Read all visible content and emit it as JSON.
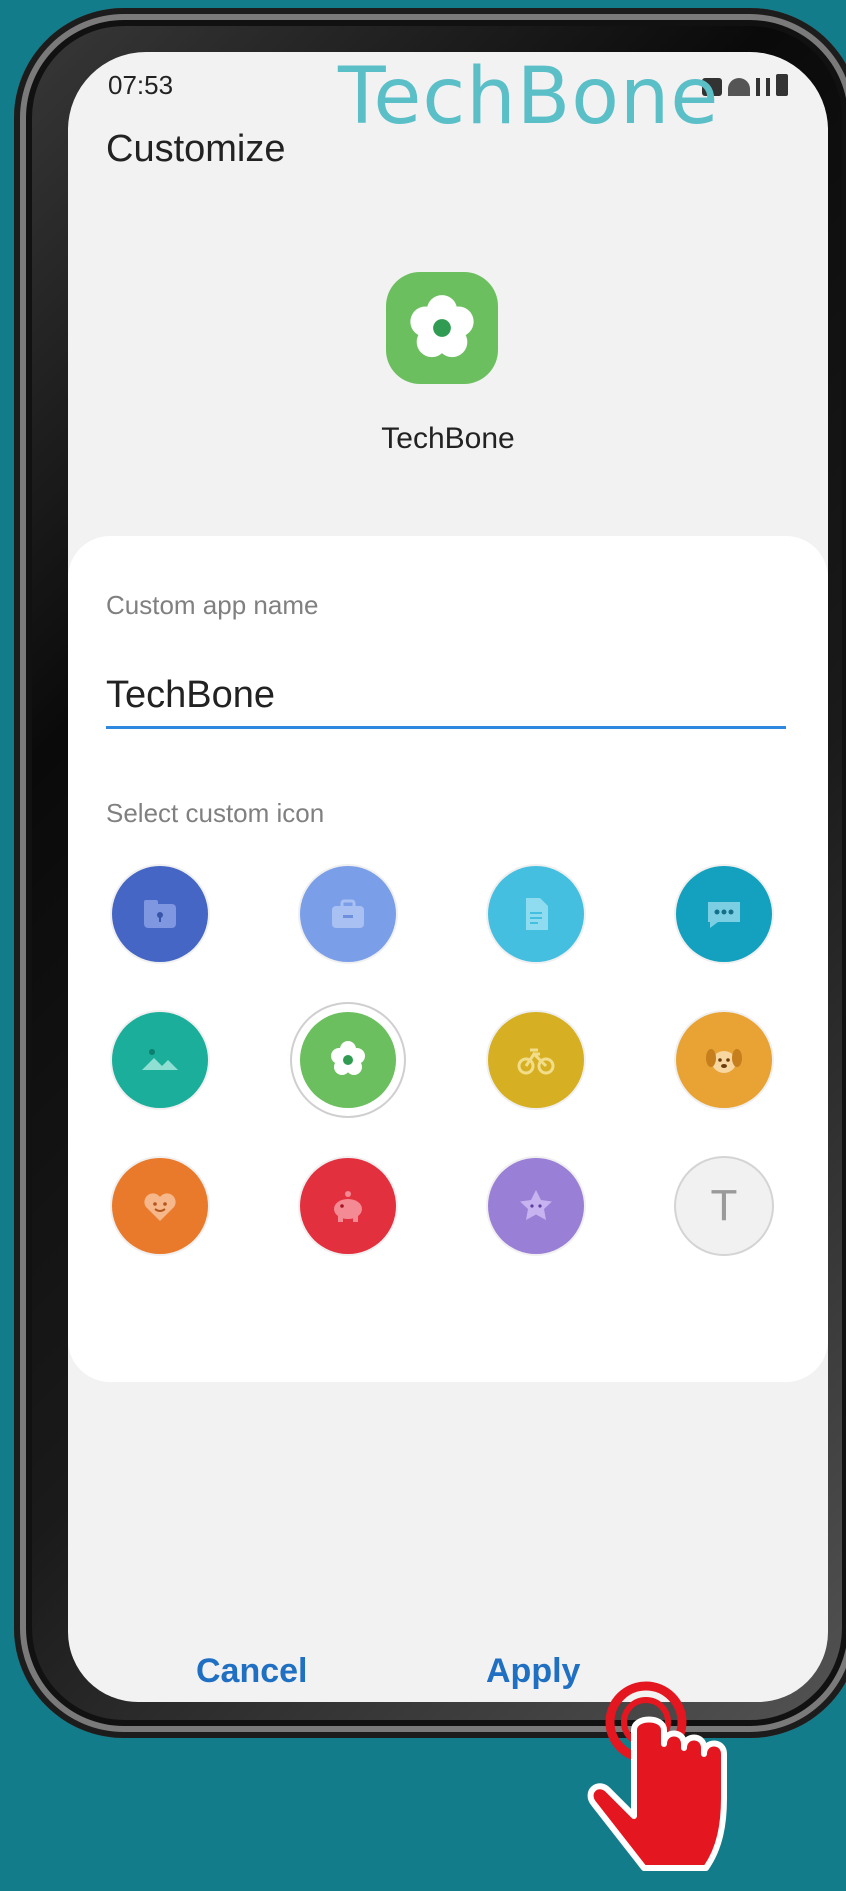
{
  "status_bar": {
    "time": "07:53"
  },
  "watermark": "TechBone",
  "header": {
    "title": "Customize"
  },
  "preview": {
    "app_name": "TechBone"
  },
  "form": {
    "name_label": "Custom app name",
    "name_value": "TechBone",
    "icon_label": "Select custom icon"
  },
  "icons": [
    {
      "name": "folder-lock-icon",
      "color": "#4566c4"
    },
    {
      "name": "briefcase-icon",
      "color": "#7b9ee8"
    },
    {
      "name": "document-icon",
      "color": "#45bfe0"
    },
    {
      "name": "chat-bubble-icon",
      "color": "#13a1bf"
    },
    {
      "name": "landscape-icon",
      "color": "#1bae9a"
    },
    {
      "name": "flower-icon",
      "color": "#6cbf5f",
      "selected": true
    },
    {
      "name": "bicycle-icon",
      "color": "#d6b022"
    },
    {
      "name": "dog-icon",
      "color": "#e8a334"
    },
    {
      "name": "heart-face-icon",
      "color": "#ea7a2b"
    },
    {
      "name": "piggy-bank-icon",
      "color": "#e3303f"
    },
    {
      "name": "star-face-icon",
      "color": "#9a7fd6"
    },
    {
      "name": "text-icon",
      "color": "#f1f1f1",
      "letter": "T"
    }
  ],
  "actions": {
    "cancel_label": "Cancel",
    "apply_label": "Apply"
  }
}
